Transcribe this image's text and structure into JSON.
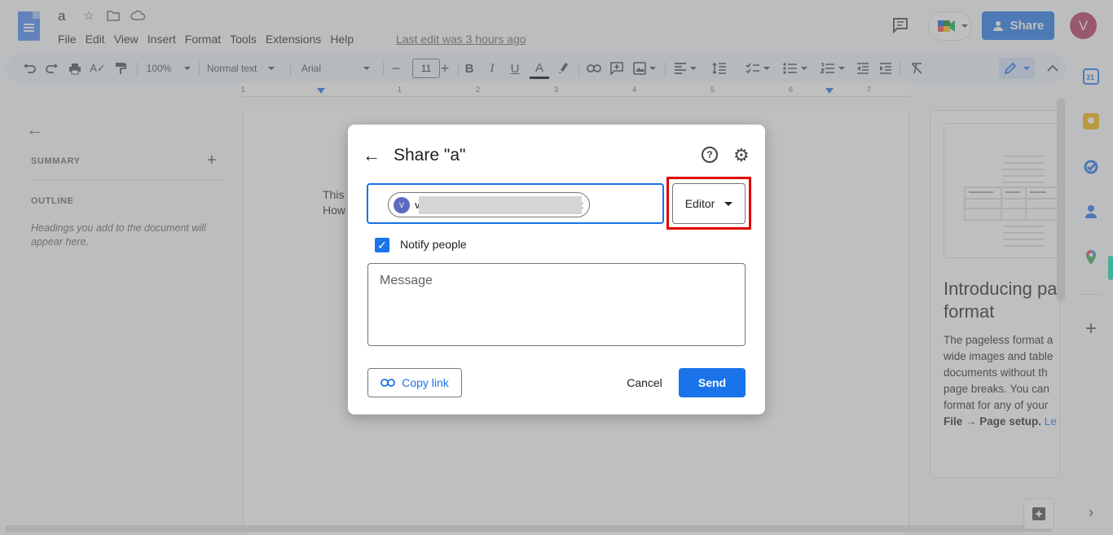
{
  "header": {
    "doc_title": "a",
    "menu": [
      "File",
      "Edit",
      "View",
      "Insert",
      "Format",
      "Tools",
      "Extensions",
      "Help"
    ],
    "last_edit": "Last edit was 3 hours ago",
    "share_label": "Share",
    "avatar_initial": "V"
  },
  "toolbar": {
    "zoom": "100%",
    "style": "Normal text",
    "font": "Arial",
    "font_size": "11",
    "bold": "B",
    "italic": "I",
    "underline": "U",
    "text_color": "A"
  },
  "ruler": [
    "1",
    "1",
    "2",
    "3",
    "4",
    "5",
    "6",
    "7"
  ],
  "outline": {
    "summary_label": "SUMMARY",
    "outline_label": "OUTLINE",
    "hint": "Headings you add to the document will appear here."
  },
  "document": {
    "line1": "This",
    "line2": "How"
  },
  "promo": {
    "title_line1": "Introducing pa",
    "title_line2": "format",
    "body": [
      "The pageless format a",
      "wide images and table",
      "documents without th",
      "page breaks. You can",
      "format for any of your"
    ],
    "bold_text": "File → Page setup.",
    "link_text": "Le"
  },
  "dialog": {
    "title": "Share \"a\"",
    "help_glyph": "?",
    "chip_initial": "V",
    "chip_text": "v",
    "role": "Editor",
    "notify_label": "Notify people",
    "notify_checked": true,
    "message_placeholder": "Message",
    "copy_link": "Copy link",
    "cancel": "Cancel",
    "send": "Send"
  },
  "colors": {
    "accent": "#1a73e8",
    "highlight": "#e00000",
    "avatar": "#b23159"
  }
}
